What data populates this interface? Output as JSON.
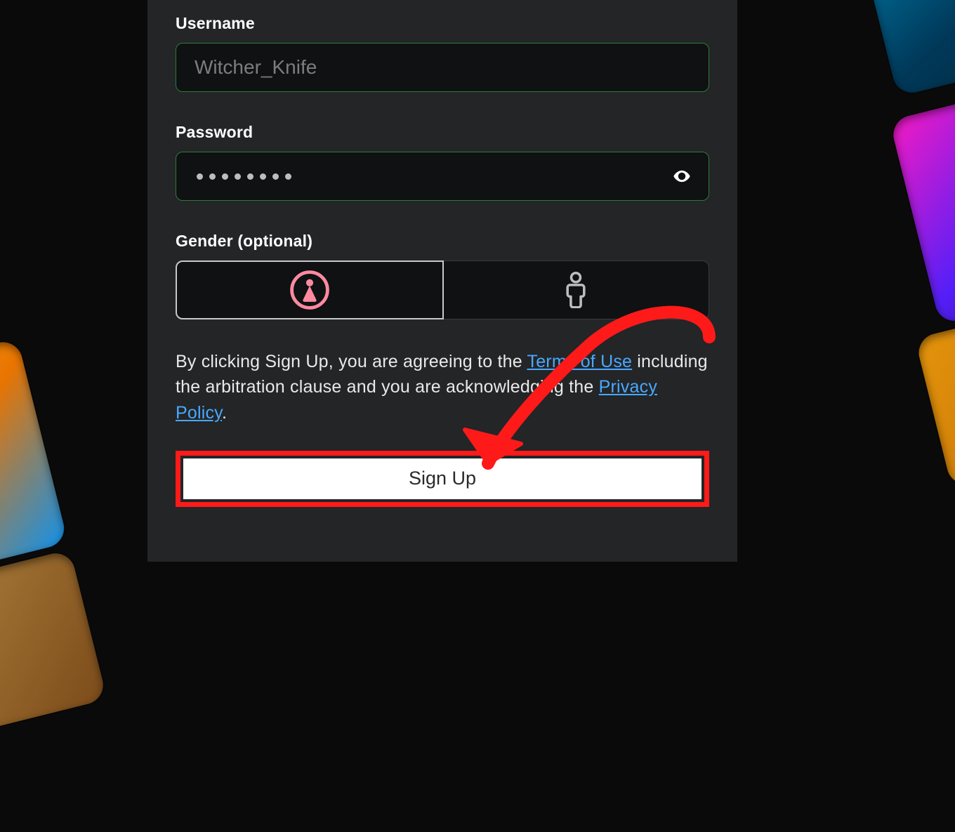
{
  "form": {
    "username_label": "Username",
    "username_value": "Witcher_Knife",
    "password_label": "Password",
    "password_value_masked_dots": 8,
    "gender_label": "Gender (optional)",
    "gender_options": {
      "female": "female",
      "male": "male"
    },
    "gender_selected": "female"
  },
  "agreement": {
    "part1": "By clicking Sign Up, you are agreeing to the ",
    "terms_link": "Terms of Use",
    "part2": " including the arbitration clause and you are acknowledging the ",
    "privacy_link": "Privacy Policy",
    "part3": "."
  },
  "signup_button_label": "Sign Up",
  "colors": {
    "panel_bg": "#232527",
    "input_bg": "#0f1112",
    "input_border_valid": "#2e7a3a",
    "link": "#4aa8ff",
    "female_icon": "#fd8aa0",
    "male_icon": "#bdbdbd",
    "highlight_red": "#ff1a1a"
  }
}
